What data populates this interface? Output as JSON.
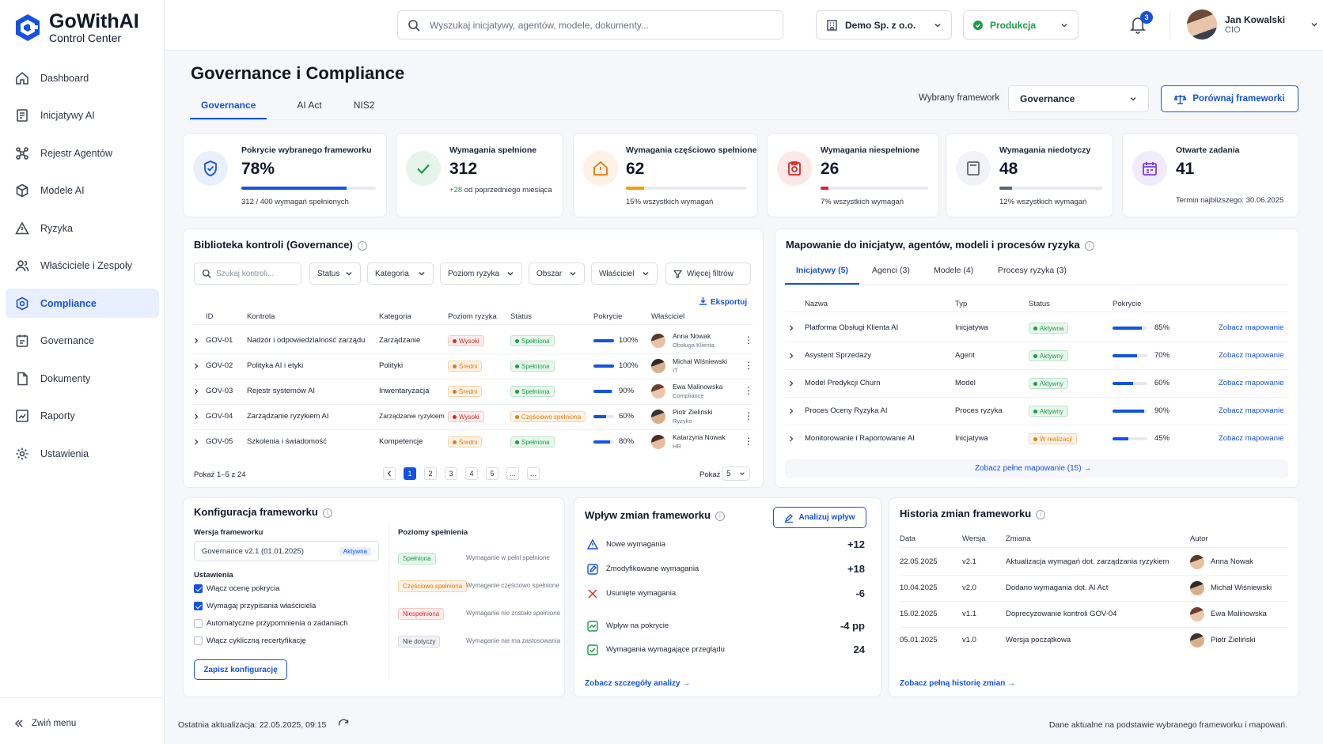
{
  "app": {
    "name": "GoWithAI",
    "subtitle": "Control Center"
  },
  "colors": {
    "accent": "#1652e0",
    "success": "#1e9b48",
    "warning": "#f59e0b",
    "danger": "#dc2626",
    "neutral": "#6b7280",
    "purple": "#7c3aed"
  },
  "sidebar": {
    "items": [
      {
        "label": "Dashboard",
        "icon": "home-icon"
      },
      {
        "label": "Inicjatywy AI",
        "icon": "initiative-icon"
      },
      {
        "label": "Rejestr Agentów",
        "icon": "agents-icon"
      },
      {
        "label": "Modele AI",
        "icon": "cube-icon"
      },
      {
        "label": "Ryzyka",
        "icon": "warning-icon"
      },
      {
        "label": "Właściciele i Zespoły",
        "icon": "users-icon"
      },
      {
        "label": "Compliance",
        "icon": "gear-shield-icon"
      },
      {
        "label": "Governance",
        "icon": "governance-icon"
      },
      {
        "label": "Dokumenty",
        "icon": "document-icon"
      },
      {
        "label": "Raporty",
        "icon": "chart-icon"
      },
      {
        "label": "Ustawienia",
        "icon": "gear-icon"
      }
    ],
    "active_index": 6,
    "collapse_label": "Zwiń menu"
  },
  "topbar": {
    "search_placeholder": "Wyszukaj inicjatywy, agentów, modele, dokumenty...",
    "org": "Demo Sp. z o.o.",
    "env": "Produkcja",
    "notifications": "3",
    "user_name": "Jan Kowalski",
    "user_role": "CIO"
  },
  "page": {
    "title": "Governance i Compliance",
    "tabs": [
      "Governance",
      "AI Act",
      "NIS2"
    ],
    "framework_label": "Wybrany framework",
    "framework_value": "Governance",
    "compare_label": "Porównaj frameworki"
  },
  "kpis": [
    {
      "title": "Pokrycie wybranego frameworku",
      "value": "78%",
      "sub": "312 / 400 wymagań spełnionych",
      "progress": 0.78
    },
    {
      "title": "Wymagania spełnione",
      "value": "312",
      "delta": "+28",
      "delta_text": " od poprzedniego miesiąca"
    },
    {
      "title": "Wymagania częściowo spełnione",
      "value": "62",
      "sub": "15% wszystkich wymagań",
      "progress": 0.15
    },
    {
      "title": "Wymagania niespełnione",
      "value": "26",
      "sub": "7% wszystkich wymagań",
      "progress": 0.07
    },
    {
      "title": "Wymagania niedotyczy",
      "value": "48",
      "sub": "12% wszystkich wymagań",
      "progress": 0.12
    },
    {
      "title": "Otwarte zadania",
      "value": "41",
      "sub": "Termin najbliższego: 30.06.2025"
    }
  ],
  "library": {
    "title": "Biblioteka kontroli (Governance)",
    "search_placeholder": "Szukaj kontroli...",
    "filters": [
      "Status",
      "Kategoria",
      "Poziom ryzyka",
      "Obszar",
      "Właściciel"
    ],
    "more_filters": "Więcej filtrów",
    "export": "Eksportuj",
    "columns": [
      "ID",
      "Kontrola",
      "Kategoria",
      "Poziom ryzyka",
      "Status",
      "Pokrycie",
      "Właściciel"
    ],
    "rows": [
      {
        "id": "GOV-01",
        "name": "Nadzór i odpowiedzialność zarządu",
        "category": "Zarządzanie",
        "risk": "Wysoki",
        "risk_tone": "red",
        "status": "Spełniona",
        "status_tone": "green",
        "coverage": "100%",
        "coverage_value": 1.0,
        "owner": "Anna Nowak",
        "owner_role": "Obsługa Klienta"
      },
      {
        "id": "GOV-02",
        "name": "Polityka AI i etyki",
        "category": "Polityki",
        "risk": "Średni",
        "risk_tone": "orange",
        "status": "Spełniona",
        "status_tone": "green",
        "coverage": "100%",
        "coverage_value": 1.0,
        "owner": "Michał Wiśniewski",
        "owner_role": "IT"
      },
      {
        "id": "GOV-03",
        "name": "Rejestr systemów AI",
        "category": "Inwentaryzacja",
        "risk": "Średni",
        "risk_tone": "orange",
        "status": "Spełniona",
        "status_tone": "green",
        "coverage": "90%",
        "coverage_value": 0.9,
        "owner": "Ewa Malinowska",
        "owner_role": "Compliance"
      },
      {
        "id": "GOV-04",
        "name": "Zarządzanie ryzykiem AI",
        "category": "Zarządzanie ryzykiem",
        "risk": "Wysoki",
        "risk_tone": "red",
        "status": "Częściowo spełniona",
        "status_tone": "orange",
        "coverage": "60%",
        "coverage_value": 0.6,
        "owner": "Piotr Zieliński",
        "owner_role": "Ryzyko"
      },
      {
        "id": "GOV-05",
        "name": "Szkolenia i świadomość",
        "category": "Kompetencje",
        "risk": "Średni",
        "risk_tone": "orange",
        "status": "Spełniona",
        "status_tone": "green",
        "coverage": "80%",
        "coverage_value": 0.8,
        "owner": "Katarzyna Nowak",
        "owner_role": "HR"
      }
    ],
    "pagination_info": "Pokaż 1–5 z 24",
    "pages": [
      "1",
      "2",
      "3",
      "4",
      "5",
      "...",
      "…"
    ],
    "page_size_label": "Pokaż",
    "page_size": "5"
  },
  "mapping": {
    "title": "Mapowanie do inicjatyw, agentów, modeli i procesów ryzyka",
    "tabs": [
      "Inicjatywy (5)",
      "Agenci (3)",
      "Modele (4)",
      "Procesy ryzyka (3)"
    ],
    "columns": [
      "Nazwa",
      "Typ",
      "Status",
      "Pokrycie"
    ],
    "rows": [
      {
        "name": "Platforma Obsługi Klienta AI",
        "type": "Inicjatywa",
        "status": "Aktywna",
        "tone": "green",
        "coverage": "85%",
        "coverage_value": 0.85,
        "link": "Zobacz mapowanie"
      },
      {
        "name": "Asystent Sprzedaży",
        "type": "Agent",
        "status": "Aktywny",
        "tone": "green",
        "coverage": "70%",
        "coverage_value": 0.7,
        "link": "Zobacz mapowanie"
      },
      {
        "name": "Model Predykcji Churn",
        "type": "Model",
        "status": "Aktywny",
        "tone": "green",
        "coverage": "60%",
        "coverage_value": 0.6,
        "link": "Zobacz mapowanie"
      },
      {
        "name": "Proces Oceny Ryzyka AI",
        "type": "Proces ryzyka",
        "status": "Aktywny",
        "tone": "green",
        "coverage": "90%",
        "coverage_value": 0.9,
        "link": "Zobacz mapowanie"
      },
      {
        "name": "Monitorowanie i Raportowanie AI",
        "type": "Inicjatywa",
        "status": "W realizacji",
        "tone": "orange",
        "coverage": "45%",
        "coverage_value": 0.45,
        "link": "Zobacz mapowanie"
      }
    ],
    "full_link": "Zobacz pełne mapowanie (15)"
  },
  "config": {
    "title": "Konfiguracja frameworku",
    "version_label": "Wersja frameworku",
    "version_value": "Governance v2.1 (01.01.2025)",
    "version_badge": "Aktywna",
    "settings_label": "Ustawienia",
    "settings": [
      {
        "label": "Włącz ocenę pokrycia",
        "checked": true
      },
      {
        "label": "Wymagaj przypisania właściciela",
        "checked": true
      },
      {
        "label": "Automatyczne przypomnienia o zadaniach",
        "checked": false
      },
      {
        "label": "Włącz cykliczną recertyfikację",
        "checked": false
      }
    ],
    "save_label": "Zapisz konfigurację",
    "levels_label": "Poziomy spełnienia",
    "levels": [
      {
        "badge": "Spełniona",
        "tone": "green",
        "desc": "Wymaganie w pełni spełnione"
      },
      {
        "badge": "Częściowo spełniona",
        "tone": "orange",
        "desc": "Wymaganie częściowo spełnione"
      },
      {
        "badge": "Niespełniona",
        "tone": "red",
        "desc": "Wymaganie nie zostało spełnione"
      },
      {
        "badge": "Nie dotyczy",
        "tone": "gray",
        "desc": "Wymaganie nie ma zastosowania"
      }
    ]
  },
  "impact": {
    "title": "Wpływ zmian frameworku",
    "analyze_label": "Analizuj wpływ",
    "rows": [
      {
        "label": "Nowe wymagania",
        "value": "+12",
        "icon": "new-icon"
      },
      {
        "label": "Zmodyfikowane wymagania",
        "value": "+18",
        "icon": "edit-icon"
      },
      {
        "label": "Usunięte wymagania",
        "value": "-6",
        "icon": "remove-icon"
      },
      {
        "label": "Wpływ na pokrycie",
        "value": "-4 pp",
        "icon": "trend-icon"
      },
      {
        "label": "Wymagania wymagające przeglądu",
        "value": "24",
        "icon": "review-icon"
      }
    ],
    "link": "Zobacz szczegóły analizy"
  },
  "history": {
    "title": "Historia zmian frameworku",
    "columns": [
      "Data",
      "Wersja",
      "Zmiana",
      "Autor"
    ],
    "rows": [
      {
        "date": "22.05.2025",
        "version": "v2.1",
        "change": "Aktualizacja wymagań dot. zarządzania ryzykiem",
        "author": "Anna Nowak"
      },
      {
        "date": "10.04.2025",
        "version": "v2.0",
        "change": "Dodano wymagania dot. AI Act",
        "author": "Michał Wiśniewski"
      },
      {
        "date": "15.02.2025",
        "version": "v1.1",
        "change": "Doprecyzowanie kontroli GOV-04",
        "author": "Ewa Malinowska"
      },
      {
        "date": "05.01.2025",
        "version": "v1.0",
        "change": "Wersja początkowa",
        "author": "Piotr Zieliński"
      }
    ],
    "link": "Zobacz pełną historię zmian"
  },
  "footer": {
    "updated": "Ostatnia aktualizacja: 22.05.2025, 09:15",
    "note": "Dane aktualne na podstawie wybranego frameworku i mapowań."
  }
}
